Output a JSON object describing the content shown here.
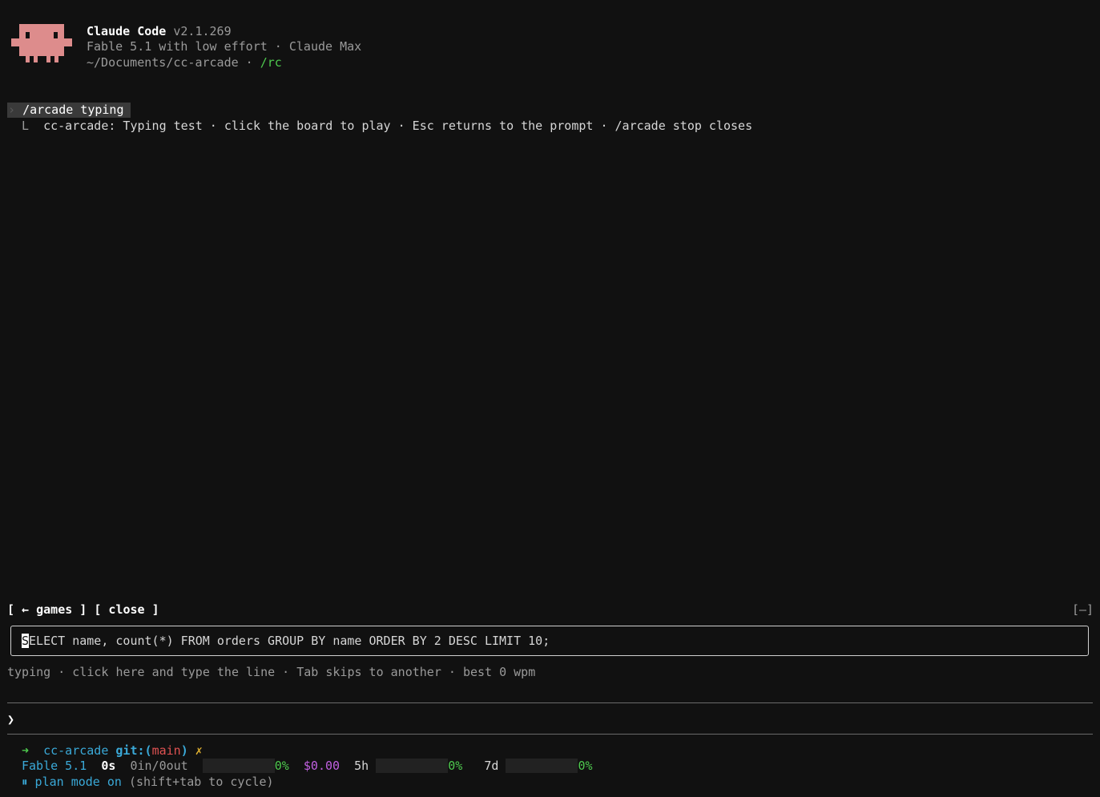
{
  "header": {
    "app_name": "Claude Code",
    "version": "v2.1.269",
    "model_line": "Fable 5.1 with low effort · Claude Max",
    "path": "~/Documents/cc-arcade",
    "path_sep": " · ",
    "rc": "/rc"
  },
  "transcript": {
    "prompt_chevron": "›",
    "command": "/arcade typing",
    "reply_marker": "L",
    "reply": "cc-arcade: Typing test · click the board to play · Esc returns to the prompt · /arcade stop closes"
  },
  "game_panel": {
    "games_button": "[ ← games ]",
    "close_button": "[ close ]",
    "minimize_button": "[—]",
    "target_first_char": "S",
    "target_rest": "ELECT name, count(*) FROM orders GROUP BY name ORDER BY 2 DESC LIMIT 10;",
    "hint": "typing · click here and type the line · Tab skips to another · best 0 wpm"
  },
  "prompt": {
    "chevron": "❯",
    "value": ""
  },
  "statusline": {
    "arrow": "➜",
    "dir": "cc-arcade",
    "git_label": "git:(",
    "branch": "main",
    "git_close": ")",
    "dirty": "✗",
    "model": "Fable 5.1",
    "elapsed": "0s",
    "tokens": "0in/0out",
    "context_pct": "0%",
    "context_fraction": 0,
    "cost": "$0.00",
    "five_h_label": "5h",
    "five_h_pct": "0%",
    "five_h_fraction": 0,
    "seven_d_label": "7d",
    "seven_d_pct": "0%",
    "seven_d_fraction": 0,
    "mode_icon": "⏸",
    "mode_text": "plan mode on",
    "mode_hint": "(shift+tab to cycle)"
  },
  "colors": {
    "background": "#111111",
    "logo": "#dd8c8c",
    "accent_green": "#4ec94e",
    "accent_cyan": "#3aa9d8",
    "branch_red": "#e05252",
    "cost_purple": "#c060e0"
  }
}
